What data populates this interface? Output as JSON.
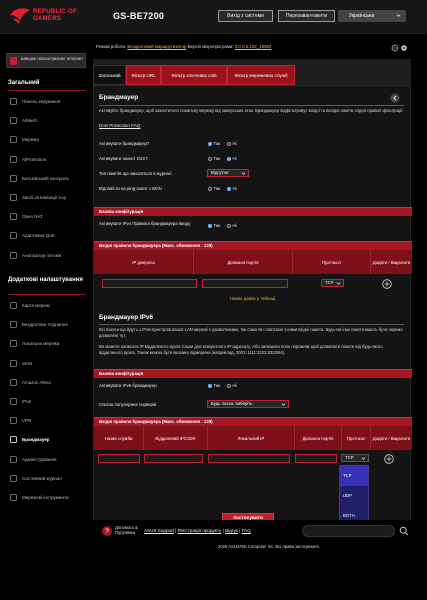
{
  "header": {
    "brand_line1": "REPUBLIC OF",
    "brand_line2": "GAMERS",
    "model": "GS-BE7200",
    "logout_label": "Вихід з системи",
    "reboot_label": "Перезавантажити",
    "language": "Українська"
  },
  "infobar": {
    "mode_label": "Режим роботи:",
    "mode_value": "Бездротовий маршрутизатор",
    "fw_label": "Версія мікропрограми:",
    "fw_value": "3.0.0.6.102_18882"
  },
  "sidebar": {
    "top_item": "Швидке налаштування Інтернет",
    "section_general": "Загальний",
    "general_items": [
      "Панель керування",
      "AiMesh",
      "Мережа",
      "AiProtection",
      "Батьківський контроль",
      "Засіб оптимізації ігор",
      "Open NAT",
      "Адаптивна QoE",
      "Аналізатор потоків"
    ],
    "section_advanced": "Додаткові налаштування",
    "advanced_items": [
      "Карта мережі",
      "Бездротове з'єднання",
      "Локальна мережа",
      "WAN",
      "Amazon Alexa",
      "IPv6",
      "VPN",
      "Брандмауер",
      "Адміністрування",
      "Системний журнал",
      "Мережеві інструменти"
    ]
  },
  "tabs": [
    "Загальний",
    "Фільтр URL",
    "Фільтр ключових слів",
    "Фільтр мережевих служб"
  ],
  "firewall": {
    "title": "Брандмауер",
    "desc": "Активуйте брандмауер, щоб захиститися локальну мережу від хакерських атак. Брандмауер відфільтровує вхідні та вихідні пакети згідно правил фільтрації.",
    "dos_link": "DoS Protection FAQ",
    "enable_label": "Активувати брандмауер?",
    "dos_label": "Активувати захист DoS?",
    "log_label": "Тип пакетів що заносяться в журнал:",
    "log_value": "Відсутня",
    "ping_label": "Відповісти на ping-запит з WAN",
    "yes": "Так",
    "no": "Ні"
  },
  "ipv4": {
    "basic_title": "Базова конфігурація",
    "inbound_label": "Активувати IPv4 Правила брандмауера вводу",
    "rules_title": "Вхідні правила брандмауера (Макс. обмеження : 128)",
    "col_source_ip": "IP джерела",
    "col_port_range": "Діапазон портів",
    "col_protocol": "Протокол",
    "col_add_delete": "Додати / Видалити",
    "protocol_value": "TCP",
    "no_data": "Немає даних у таблиці."
  },
  "ipv6": {
    "title": "Брандмауер IPv6",
    "desc1": "Всі пакети що йдуть з IPv6-пристроїв вашої LAN-мережі є дозволеними, так само як і пов'язані з ними вхідні пакети. Будь-які інші пакети мають бути окремо дозволені тут.",
    "desc2": "Ви можете написати IP віддаленого вузла тільки для конкретного IP-адресату. Або залишити поле порожнім щоб дозволити пакети від будь-якого віддаленого вузла. Також можна бути вказана підмережа (наприклад, 2001::1111:2222:3333/64).",
    "basic_title": "Базова конфігурація",
    "enable_label": "Активувати IPv6 брандмауер",
    "popular_label": "Список популярних серверів",
    "popular_value": "Будь ласка, виберіть",
    "rules_title": "Вхідні правила брандмауера (Макс. обмеження : 128)",
    "col_service": "Назва служби",
    "col_remote_ip": "Віддалений IP/CIDR",
    "col_local_ip": "Локальний IP",
    "col_port_range": "Діапазон портів",
    "col_protocol": "Протокол",
    "col_add_delete": "Додати / Видалити",
    "protocol_value": "TCP",
    "protocol_options": [
      "TCP",
      "UDP",
      "BOTH",
      "OTHER"
    ]
  },
  "apply_label": "Застосувати",
  "footer": {
    "help": "Допомога & Підтримка",
    "links": [
      "ASUS Support",
      "Реєстрація продукту",
      "Відгук",
      "FAQ"
    ],
    "copyright": "2026 ASUSTeK Computer Inc. Всі права застережені."
  }
}
